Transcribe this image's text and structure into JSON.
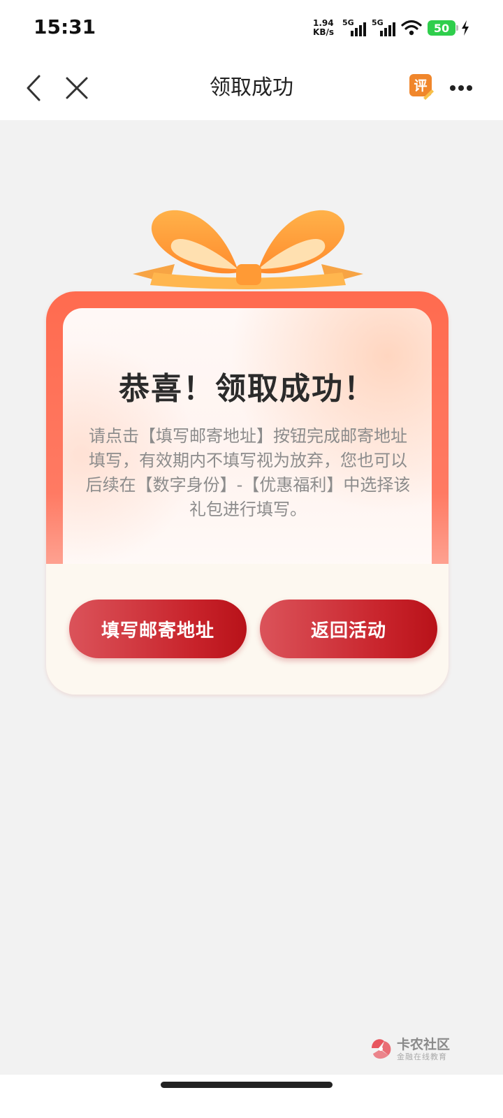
{
  "status_bar": {
    "time": "15:31",
    "net_speed_value": "1.94",
    "net_speed_unit": "KB/s",
    "sim1_tag": "5G",
    "sim2_tag": "5G",
    "battery": "50"
  },
  "nav": {
    "title": "领取成功",
    "rate_icon_char": "评"
  },
  "card": {
    "title": "恭喜！领取成功！",
    "description": "请点击【填写邮寄地址】按钮完成邮寄地址填写，有效期内不填写视为放弃，您也可以后续在【数字身份】-【优惠福利】中选择该礼包进行填写。"
  },
  "buttons": {
    "fill_address": "填写邮寄地址",
    "back_activity": "返回活动"
  },
  "watermark": {
    "title": "卡农社区",
    "subtitle": "金融在线教育"
  },
  "colors": {
    "accent_red": "#c8232b",
    "battery_green": "#2fce4c",
    "card_top": "#ff6b4f"
  }
}
